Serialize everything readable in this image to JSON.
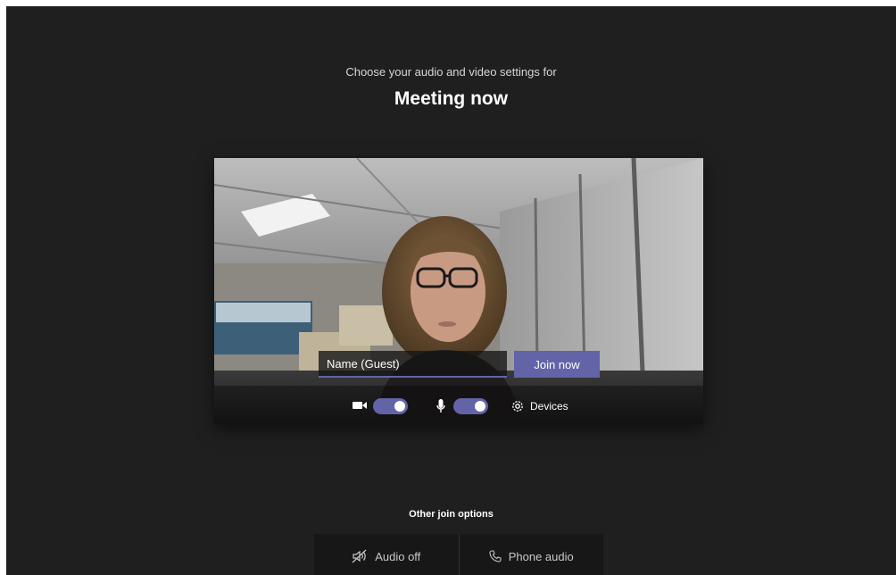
{
  "header": {
    "subtitle": "Choose your audio and video settings for",
    "meeting_title": "Meeting now"
  },
  "preview": {
    "name_value": "Name (Guest)",
    "join_label": "Join now",
    "camera_on": true,
    "mic_on": true,
    "devices_label": "Devices"
  },
  "other_options": {
    "label": "Other join options",
    "audio_off_label": "Audio off",
    "phone_audio_label": "Phone audio"
  },
  "colors": {
    "background": "#201f1f",
    "accent": "#6264a7",
    "options_bar": "#171717"
  },
  "icons": [
    "camera-icon",
    "microphone-icon",
    "gear-icon",
    "speaker-off-icon",
    "phone-icon"
  ]
}
